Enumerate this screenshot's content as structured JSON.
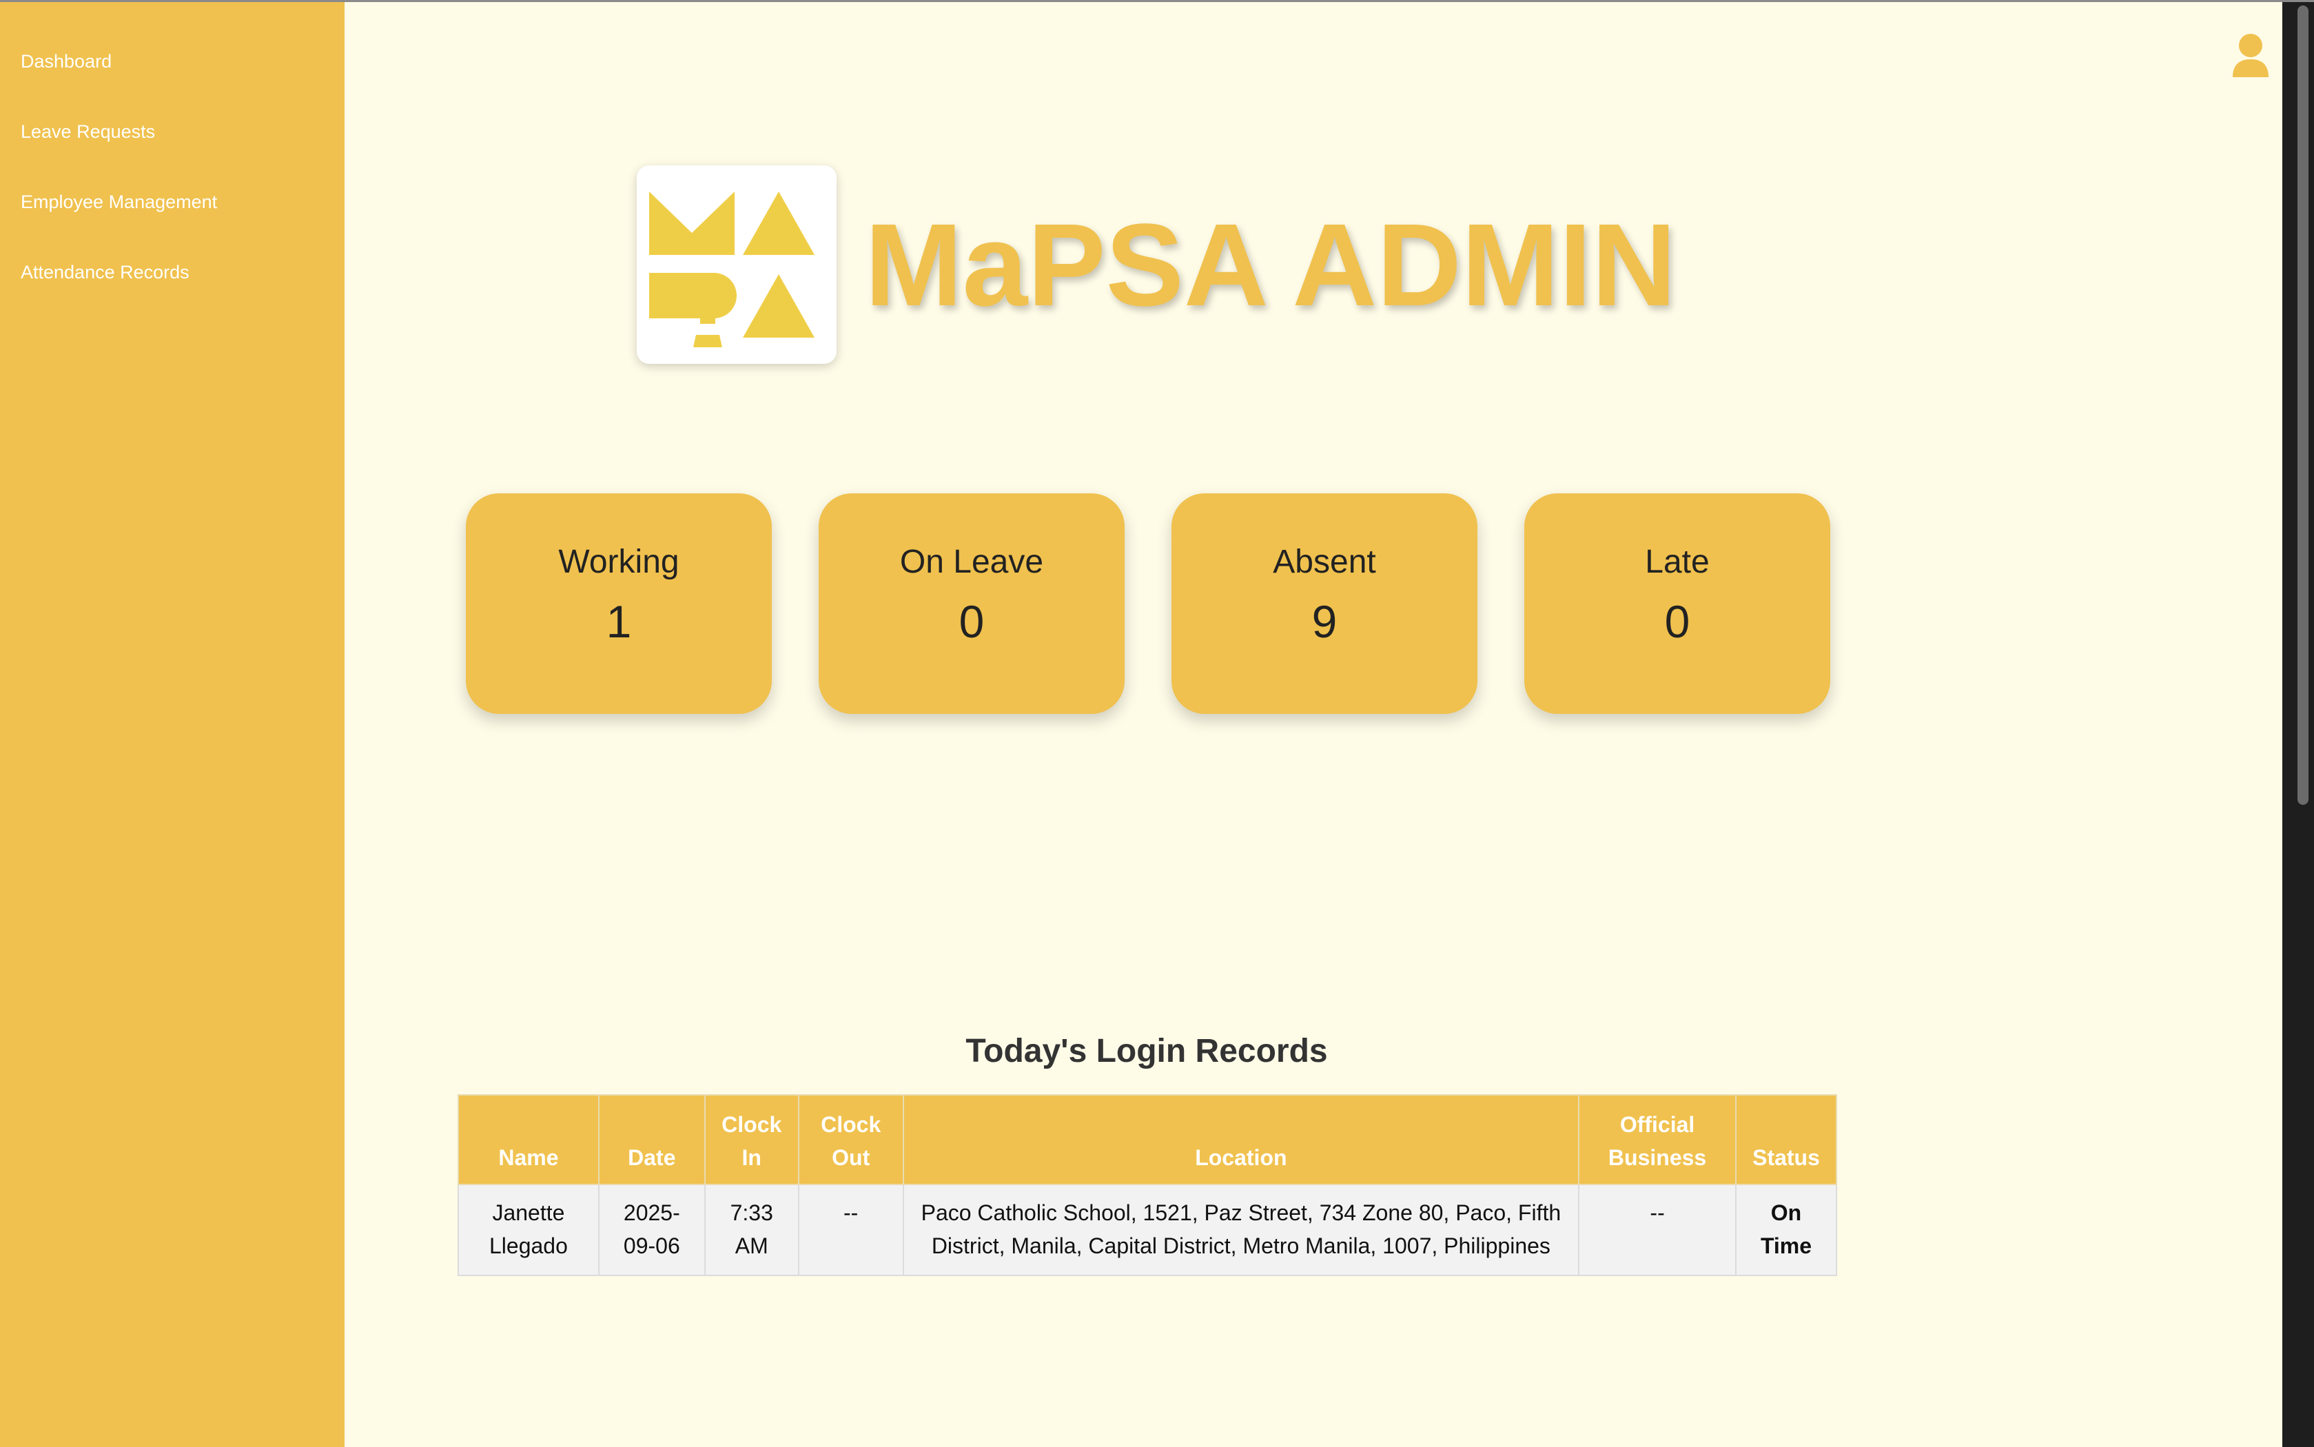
{
  "sidebar": {
    "items": [
      {
        "label": "Dashboard"
      },
      {
        "label": "Leave Requests"
      },
      {
        "label": "Employee Management"
      },
      {
        "label": "Attendance Records"
      }
    ]
  },
  "header": {
    "brand_title": "MaPSA ADMIN",
    "user_icon": "user-icon"
  },
  "stats": [
    {
      "label": "Working",
      "value": "1"
    },
    {
      "label": "On Leave",
      "value": "0"
    },
    {
      "label": "Absent",
      "value": "9"
    },
    {
      "label": "Late",
      "value": "0"
    }
  ],
  "login_records": {
    "title": "Today's Login Records",
    "columns": [
      "Name",
      "Date",
      "Clock In",
      "Clock Out",
      "Location",
      "Official Business",
      "Status"
    ],
    "rows": [
      {
        "name": "Janette Llegado",
        "date": "2025-09-06",
        "clock_in": "7:33 AM",
        "clock_out": "--",
        "location": "Paco Catholic School, 1521, Paz Street, 734 Zone 80, Paco, Fifth District, Manila, Capital District, Metro Manila, 1007, Philippines",
        "official_business": "--",
        "status": "On Time"
      }
    ]
  },
  "colors": {
    "accent": "#f0c14e",
    "background": "#fefbe7",
    "sidebar_text": "#ffffff",
    "logo_yellow": "#efce47"
  }
}
